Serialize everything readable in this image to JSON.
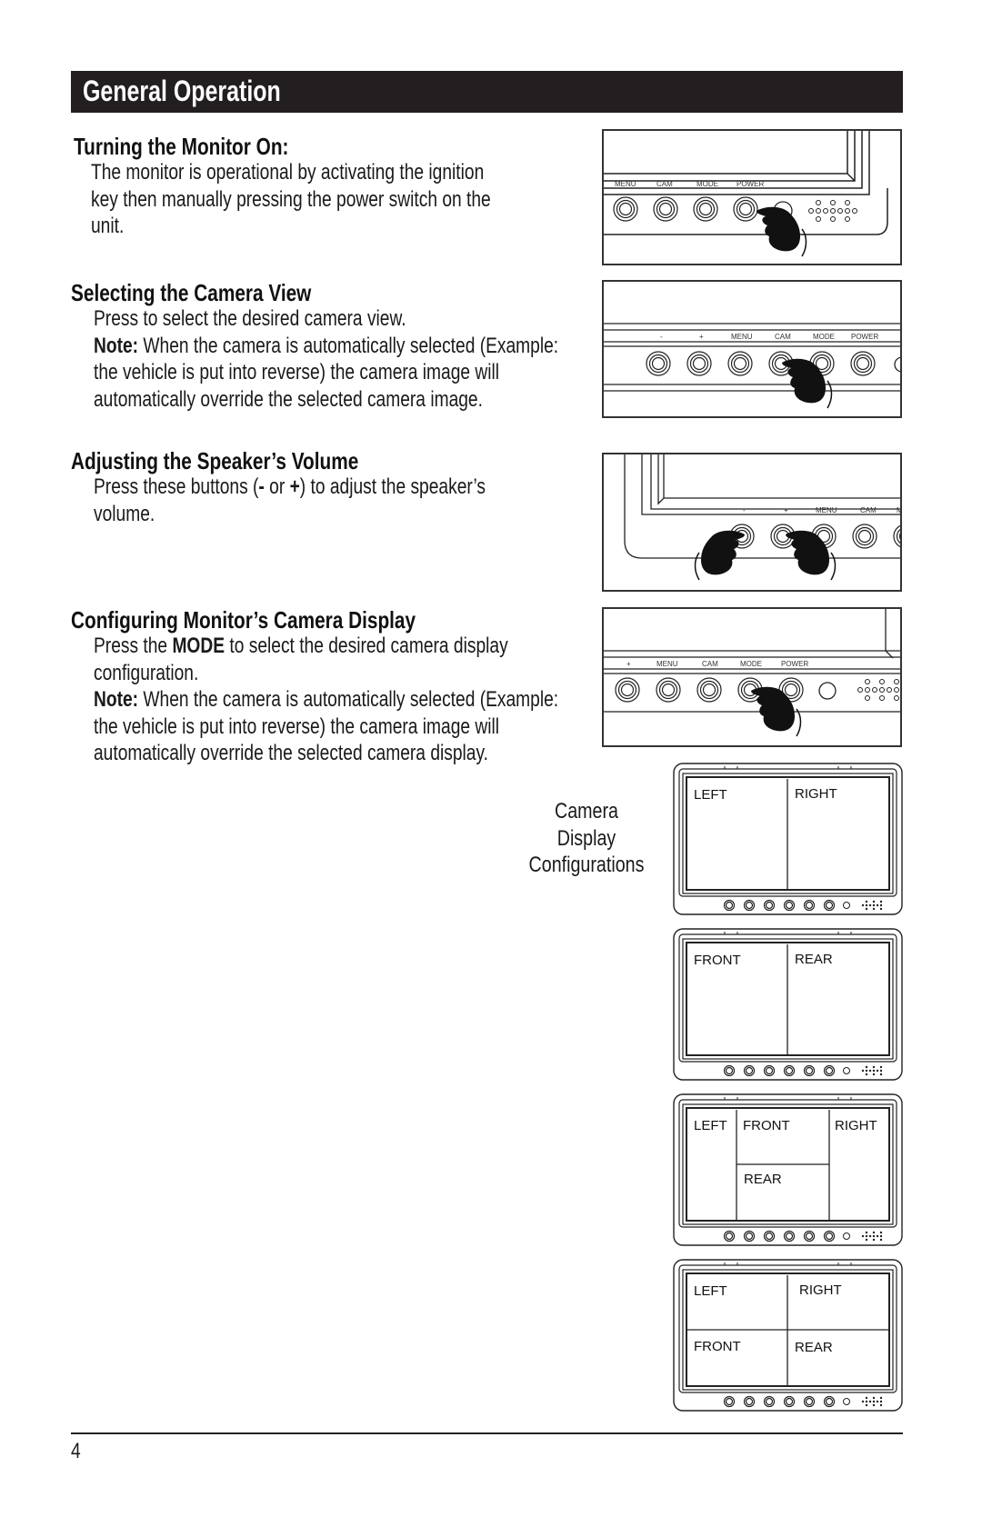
{
  "header": {
    "title": "General Operation"
  },
  "sections": [
    {
      "heading": "Turning the Monitor On:",
      "lines": [
        "The monitor is operational by activating the ignition",
        "key then manually pressing the power switch on the",
        "unit."
      ]
    },
    {
      "heading": "Selecting the Camera View",
      "lines": [
        "Press to select the desired camera view."
      ],
      "note_label": "Note:",
      "note_lines": [
        " When the camera is automatically selected (Example:",
        "the vehicle is put into reverse) the camera image will",
        "automatically override the selected camera image."
      ]
    },
    {
      "heading": "Adjusting the Speaker’s Volume",
      "line1_pre": "Press these buttons (",
      "minus": "-",
      "or": " or ",
      "plus": "+",
      "line1_post": ") to adjust the speaker’s",
      "line2": "volume."
    },
    {
      "heading": "Configuring Monitor’s Camera Display",
      "line1_pre": "Press the ",
      "mode": "MODE",
      "line1_post": " to select the desired camera display",
      "line2": "configuration.",
      "note_label": "Note:",
      "note_lines": [
        " When the camera is automatically selected (Example:",
        "the vehicle is put into reverse) the camera image will",
        "automatically override the selected camera display."
      ]
    }
  ],
  "panels": {
    "power": {
      "labels": [
        "MENU",
        "CAM",
        "MODE",
        "POWER"
      ],
      "pressed": "POWER"
    },
    "camera": {
      "labels": [
        "-",
        "+",
        "MENU",
        "CAM",
        "MODE",
        "POWER"
      ],
      "pressed": "CAM"
    },
    "volume": {
      "labels": [
        "-",
        "+",
        "MENU",
        "CAM",
        "M"
      ],
      "pressed": [
        "-",
        "+"
      ]
    },
    "mode": {
      "labels": [
        "+",
        "MENU",
        "CAM",
        "MODE",
        "POWER"
      ],
      "pressed": "MODE"
    }
  },
  "camera_caption": [
    "Camera",
    "Display",
    "Configurations"
  ],
  "configurations": [
    {
      "layout": "split-2",
      "labels": [
        "LEFT",
        "RIGHT"
      ]
    },
    {
      "layout": "split-2",
      "labels": [
        "FRONT",
        "REAR"
      ]
    },
    {
      "layout": "split-3",
      "labels": [
        "LEFT",
        "FRONT",
        "RIGHT",
        "REAR"
      ]
    },
    {
      "layout": "quad",
      "labels": [
        "LEFT",
        "RIGHT",
        "FRONT",
        "REAR"
      ]
    }
  ],
  "footer": {
    "page_number": "4"
  },
  "icons": {
    "hand": "pointing-hand-icon",
    "button": "round-button-icon",
    "speaker": "speaker-grille-icon"
  }
}
